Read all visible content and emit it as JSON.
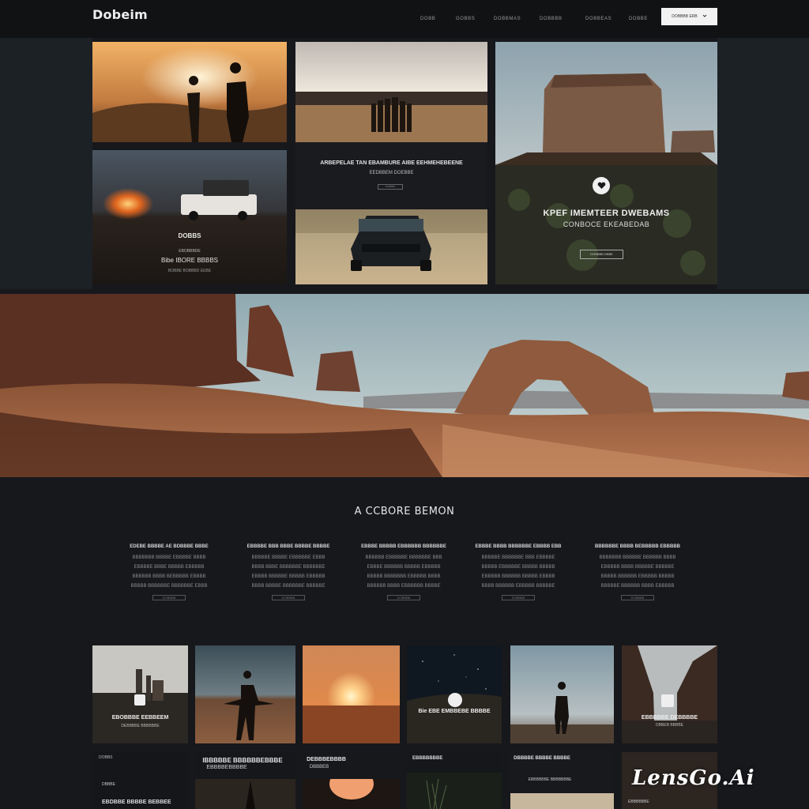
{
  "brand": {
    "logo": "Dobeim"
  },
  "nav": {
    "items": [
      "DOBB",
      "GOBBS",
      "DOBBMAS",
      "DOBBBB",
      "DOBBEAS",
      "DOBBE"
    ],
    "button_label": "DOBBBB ERB",
    "button_icon": "chevron-icon"
  },
  "grid": {
    "middle_card": {
      "title": "ARBEPELAE TAN EBAMBURE AIBE EEHMEHEBEENE",
      "subtitle": "EEDBBEM DOEBBE",
      "button": "DOBBBE"
    },
    "left_card": {
      "title": "DOBBS",
      "line1": "EBOBBBDE",
      "line2": "Bibe IBORE BBBBS",
      "line3": "BOBBE BOBBBD EEBE"
    },
    "right_card": {
      "icon": "heart-icon",
      "title": "KPEF IMEMTEER DWEBAMS",
      "subtitle": "CONBOCE EKEABEDAB",
      "button": "DOBBBB DBBE"
    }
  },
  "features": {
    "title": "A CCBORE BEMON",
    "columns": [
      {
        "head": "EDEBE BBBBE AE BDBBBE BBBE",
        "lines": [
          "BBBBBBB BBBBE EBBBBE BBBB",
          "EBBBBE BBBE BBBBB EBBBBB",
          "BBBBBB BBBB BEBBBBB EBBBB",
          "BBBBB BBBBBBE BBBBBBE EBBB"
        ],
        "button": "DOBBBB"
      },
      {
        "head": "EBBBBE BBB BBBE BBBBE BBBBE",
        "lines": [
          "BBBBBE BBBBE EBBBBBE EBBB",
          "BBBB BBBE BBBBBBE BBBBBBE",
          "EBBBB BBBBBE BBBBB EBBBBB",
          "BBBB BBBBE BBBBBBE BBBBBE"
        ],
        "button": "DOBBBB"
      },
      {
        "head": "EBBBE BBBBB EBBBBBB BBBBBBE",
        "lines": [
          "BBBBBB EBBBBBE BBBBBBE BBB",
          "EBBBE BBBBBB BBBBB EBBBBB",
          "BBBBB BBBBBBB EBBBBB BBBB",
          "BBBBBB BBBB EBBBBBB BBBBE"
        ],
        "button": "DOBBBB"
      },
      {
        "head": "EBBBE BBBB BBBBBBE EBBBB EBB",
        "lines": [
          "BBBBBE BBBBBBE BBB EBBBBE",
          "BBBBB EBBBBBE BBBBB BBBBB",
          "EBBBBB BBBBBB BBBBB EBBBB",
          "BBBB BBBBBB EBBBBB BBBBBE"
        ],
        "button": "DOBBBB"
      },
      {
        "head": "BBBBBBE BBBB BEBBBBB EBBBBB",
        "lines": [
          "BBBBBBB BBBBBE BBBBBB BBBB",
          "EBBBBB BBBB BBBBBE BBBBBE",
          "BBBBB BBBBBB EBBBBB BBBBB",
          "BBBBBE BBBBBB BBBB EBBBBB"
        ],
        "button": "DOBBBB"
      }
    ]
  },
  "gallery": {
    "row1": [
      {
        "label": "EBOBBBE EEBBEEM",
        "sub": "DEBBBBE BBBBBBE"
      },
      {
        "label": "",
        "sub": ""
      },
      {
        "label": "",
        "sub": ""
      },
      {
        "label": "Bie EBE EMBBEBE BBBBE",
        "sub": ""
      },
      {
        "label": "",
        "sub": ""
      },
      {
        "label": "EBBBBBE DEBBBBE",
        "sub": "DBBEB BBBBE"
      }
    ],
    "row2": [
      {
        "label": "DOBBS",
        "sub": "DBBBE",
        "foot": "EBDBBE BBBBE BEBBEE"
      },
      {
        "label": "IBBBBBE BBBBBBEBBBE",
        "sub": "EBBBBEBBBBE"
      },
      {
        "label": "DEBBBEBBBB",
        "sub": "DBBBEB"
      },
      {
        "label": "EBBBBBBBE",
        "sub": ""
      },
      {
        "label": "DBBBBE BBBBE BBBBE",
        "sub": "EBBBBBBE BBBBBBBE"
      },
      {
        "label": "EBBBBBBE",
        "sub": ""
      }
    ]
  },
  "watermark": "LensGo.Ai"
}
